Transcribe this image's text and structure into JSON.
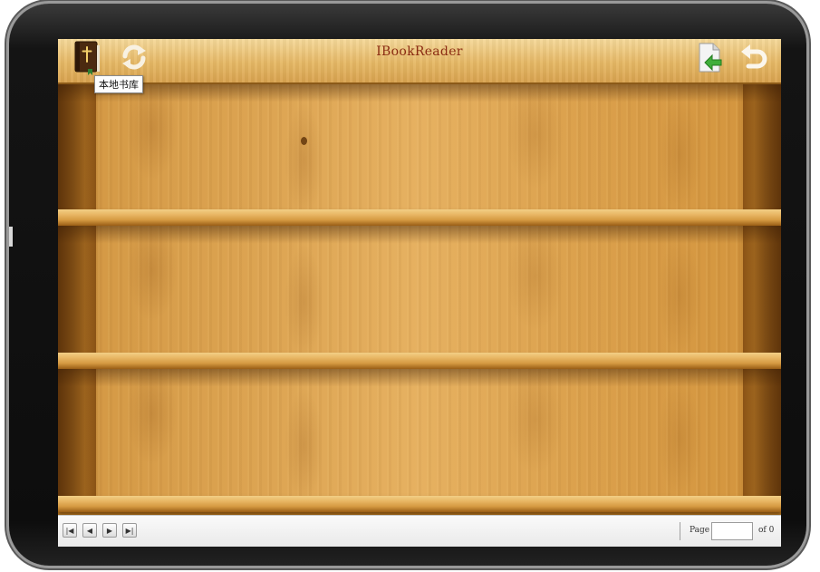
{
  "app": {
    "title": "IBookReader"
  },
  "toolbar": {
    "local_library_tooltip": "本地书库",
    "icons": {
      "library": "bible-book-icon",
      "refresh": "refresh-icon",
      "import": "import-document-icon",
      "back": "back-arrow-icon"
    }
  },
  "pager": {
    "page_label": "Page",
    "page_value": "",
    "of_label": "of",
    "total_pages": "0"
  },
  "colors": {
    "title": "#8a2b12",
    "wood_light": "#e6b161",
    "wood_dark": "#a6651a"
  }
}
